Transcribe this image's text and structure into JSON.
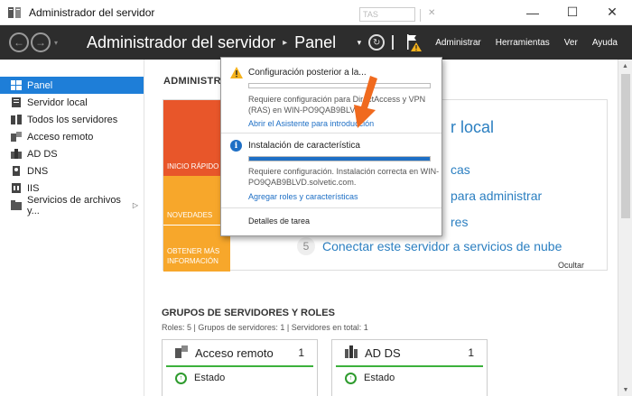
{
  "window": {
    "title": "Administrador del servidor",
    "minimize_glyph": "—",
    "maximize_glyph": "☐",
    "close_glyph": "✕"
  },
  "header": {
    "breadcrumb_root": "Administrador del servidor",
    "breadcrumb_sep": "▸",
    "breadcrumb_current": "Panel",
    "back_glyph": "←",
    "forward_glyph": "→",
    "nav_dropdown_glyph": "▾",
    "tools_dropdown_glyph": "▾",
    "refresh_glyph": "↻",
    "menu": [
      "Administrar",
      "Herramientas",
      "Ver",
      "Ayuda"
    ]
  },
  "sidebar": {
    "items": [
      {
        "label": "Panel",
        "icon": "dashboard-icon",
        "active": true
      },
      {
        "label": "Servidor local",
        "icon": "server-icon"
      },
      {
        "label": "Todos los servidores",
        "icon": "servers-icon"
      },
      {
        "label": "Acceso remoto",
        "icon": "remote-access-icon"
      },
      {
        "label": "AD DS",
        "icon": "ad-ds-icon"
      },
      {
        "label": "DNS",
        "icon": "dns-icon"
      },
      {
        "label": "IIS",
        "icon": "iis-icon"
      },
      {
        "label": "Servicios de archivos y...",
        "icon": "file-services-icon",
        "expand_glyph": "▷"
      }
    ]
  },
  "main": {
    "heading_visible": "ADMINISTRA",
    "tiles": [
      "INICIO RÁPIDO",
      "NOVEDADES",
      "OBTENER MÁS INFORMACIÓN"
    ],
    "welcome_title_fragment": "r local",
    "step_fragments": [
      "cas",
      "para administrar",
      "res"
    ],
    "step5_num": "5",
    "step5_label": "Conectar este servidor a servicios de nube",
    "hide_label": "Ocultar",
    "groups_title": "GRUPOS DE SERVIDORES Y ROLES",
    "groups_stats": "Roles: 5   |   Grupos de servidores: 1   |   Servidores en total: 1",
    "cards": [
      {
        "name": "Acceso remoto",
        "count": "1",
        "status_label": "Estado"
      },
      {
        "name": "AD DS",
        "count": "1",
        "status_label": "Estado"
      }
    ]
  },
  "notifications": {
    "select_fragment": "TAS",
    "close_glyph": "✕",
    "info_glyph": "i",
    "items": [
      {
        "type": "warning",
        "title": "Configuración posterior a la...",
        "desc_line1": "Requiere configuración para DirectAccess y VPN",
        "desc_line2": "(RAS) en WIN-PO9QAB9BLVD",
        "link": "Abrir el Asistente para introducción",
        "progress": 0
      },
      {
        "type": "info",
        "title": "Instalación de característica",
        "desc_line1": "Requiere configuración. Instalación correcta en WIN-",
        "desc_line2": "PO9QAB9BLVD.solvetic.com.",
        "link": "Agregar roles y características",
        "progress": 1
      }
    ],
    "footer": "Detalles de tarea"
  },
  "colors": {
    "accent": "#1e7ed8",
    "warning": "#f5b21c",
    "tile_orange": "#e8562a",
    "tile_yellow": "#f7a72b",
    "status_green": "#3cb13c",
    "link_blue": "#2b7fc1"
  }
}
